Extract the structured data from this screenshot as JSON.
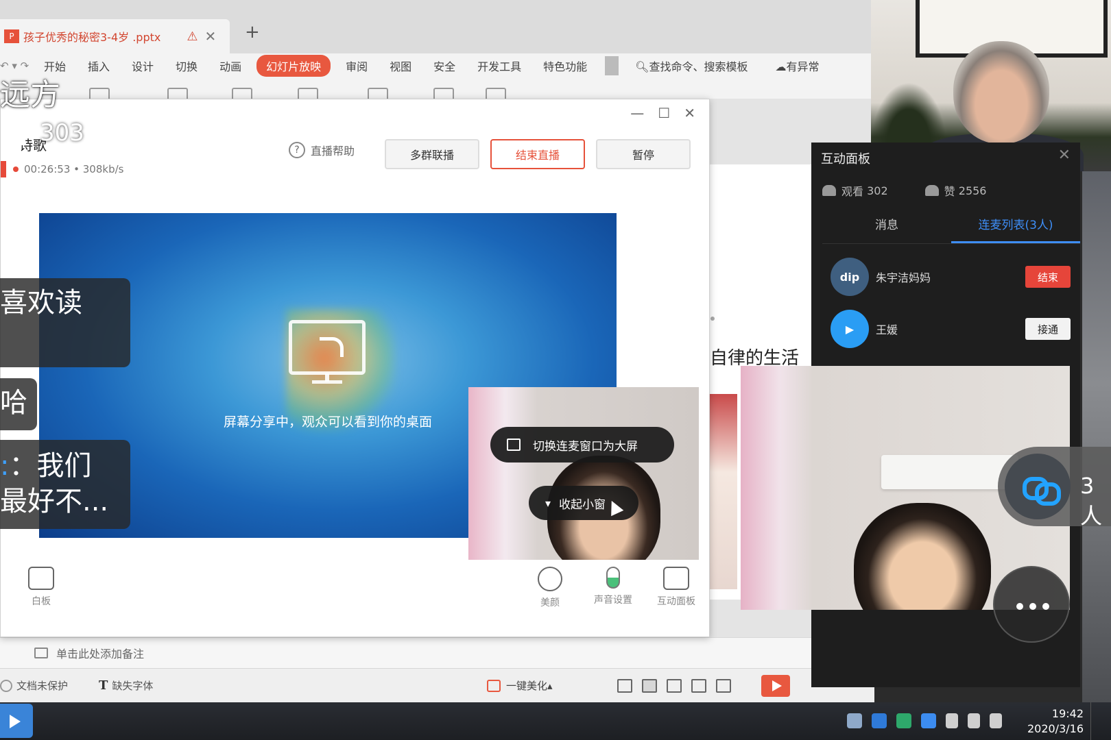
{
  "ppt": {
    "doc_tab": "孩子优秀的秘密3-4岁 .pptx",
    "doc_icon_text": "P",
    "ribbon_tabs": [
      "开始",
      "插入",
      "设计",
      "切换",
      "动画",
      "幻灯片放映",
      "审阅",
      "视图",
      "安全",
      "开发工具",
      "特色功能"
    ],
    "active_tab": "幻灯片放映",
    "search": "查找命令、搜索模板",
    "cloud": "有异常",
    "slide_text": "自律的生活",
    "notes_placeholder": "单击此处添加备注",
    "status": {
      "protect": "文档未保护",
      "font": "缺失字体",
      "beautify": "一键美化"
    }
  },
  "overlay": {
    "title": "远方",
    "viewer_count": "303",
    "subtitle": "诗歌",
    "bubbles": {
      "b1": "喜欢读",
      "b2": "哈",
      "b3_prefix": "：",
      "b3_line1": "我们",
      "b3_line2": "最好不..."
    }
  },
  "live": {
    "duration": "00:26:53",
    "bitrate": "308kb/s",
    "help": "直播帮助",
    "btn_multi": "多群联播",
    "btn_end": "结束直播",
    "btn_pause": "暂停",
    "share_msg": "屏幕分享中，观众可以看到你的桌面",
    "switch_big": "切换连麦窗口为大屏",
    "collapse": "收起小窗",
    "tools": {
      "whiteboard": "白板",
      "beauty": "美颜",
      "audio": "声音设置",
      "panel": "互动面板"
    }
  },
  "panel": {
    "title": "互动面板",
    "views_label": "观看",
    "views": "302",
    "likes_label": "赞",
    "likes": "2556",
    "tab_messages": "消息",
    "tab_mic_list": "连麦列表(3人)",
    "users": [
      {
        "name": "朱宇洁妈妈",
        "action": "结束",
        "avatar_text": "dip"
      },
      {
        "name": "王媛",
        "action": "接通"
      }
    ]
  },
  "floating": {
    "link_count": "3人"
  },
  "taskbar": {
    "time": "19:42",
    "date": "2020/3/16"
  },
  "colors": {
    "accent_red": "#e6513a",
    "accent_blue": "#3e8ef7"
  }
}
